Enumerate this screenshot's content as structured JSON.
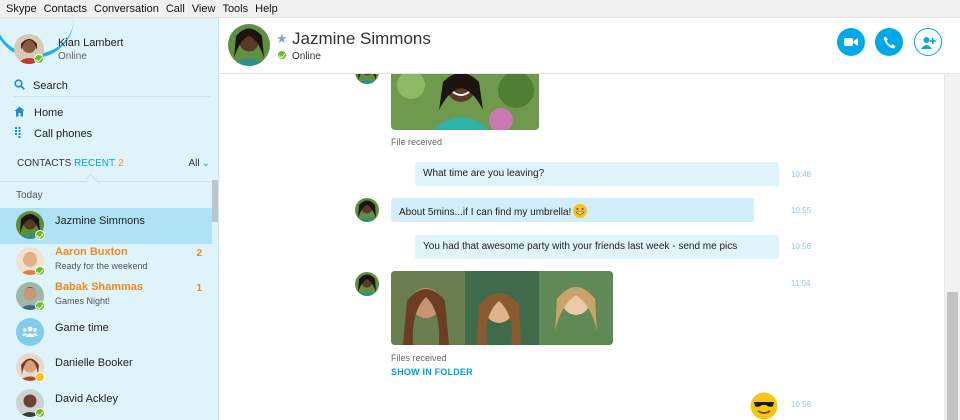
{
  "menu": [
    "Skype",
    "Contacts",
    "Conversation",
    "Call",
    "View",
    "Tools",
    "Help"
  ],
  "me": {
    "name": "Kian Lambert",
    "status": "Online"
  },
  "sidebar": {
    "search_label": "Search",
    "home_label": "Home",
    "call_phones_label": "Call phones",
    "tabs": {
      "contacts": "CONTACTS",
      "recent": "RECENT",
      "recent_count": "2",
      "filter": "All"
    },
    "section": "Today",
    "contacts": [
      {
        "name": "Jazmine Simmons",
        "status": "",
        "badge": "",
        "presence": "online",
        "active": true
      },
      {
        "name": "Aaron Buxton",
        "status": "Ready for the weekend",
        "badge": "2",
        "presence": "online"
      },
      {
        "name": "Babak Shammas",
        "status": "Games Night!",
        "badge": "1",
        "presence": "online"
      },
      {
        "name": "Game time",
        "status": "",
        "badge": "",
        "presence": "none"
      },
      {
        "name": "Danielle Booker",
        "status": "",
        "badge": "",
        "presence": "away"
      },
      {
        "name": "David Ackley",
        "status": "",
        "badge": "",
        "presence": "online"
      }
    ]
  },
  "header": {
    "name": "Jazmine Simmons",
    "status": "Online"
  },
  "conversation": {
    "file_received": "File received",
    "messages": [
      {
        "text": "What time are you leaving?",
        "time": "10:48",
        "from": "me"
      },
      {
        "text": "About 5mins...if I can find my umbrella!",
        "time": "10:55",
        "from": "them",
        "emoji": "grin"
      },
      {
        "text": "You had that awesome party with your friends last week - send me pics",
        "time": "10:56",
        "from": "me"
      }
    ],
    "photos_time": "11:04",
    "files_received": "Files received",
    "show_in_folder": "SHOW IN FOLDER",
    "emoji_time": "10:56"
  },
  "colors": {
    "accent": "#00a8e8",
    "unread": "#f08a1c",
    "online": "#6bbd22",
    "sidebar_bg": "#dff3fb"
  }
}
